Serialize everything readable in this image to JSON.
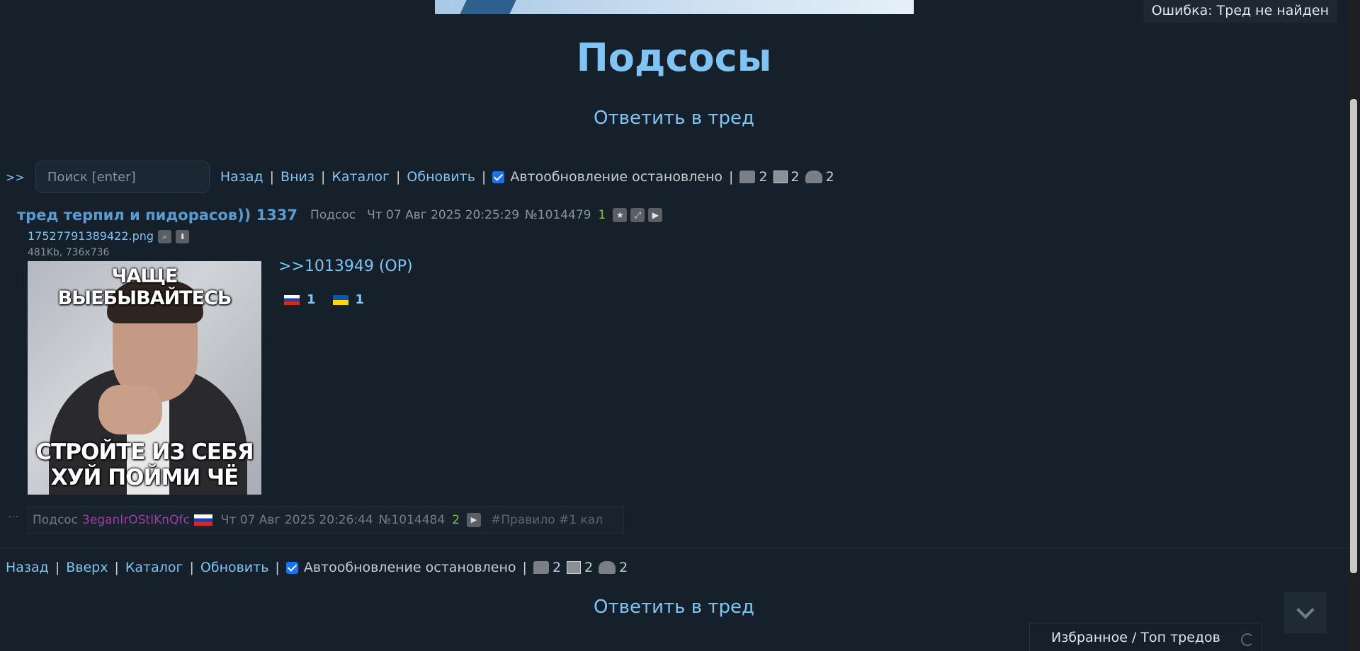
{
  "error_toast": "Ошибка: Тред не найден",
  "board": {
    "title": "Подсосы"
  },
  "reply_link": "Ответить в тред",
  "nav_top": {
    "prefix": ">>",
    "search_placeholder": "Поиск [enter]",
    "links": [
      "Назад",
      "Вниз",
      "Каталог",
      "Обновить"
    ],
    "autoupdate": "Автообновление остановлено",
    "stats": {
      "posts": "2",
      "images": "2",
      "users": "2"
    }
  },
  "op": {
    "subject": "тред терпил и пидорасов)) 1337",
    "name": "Подсос",
    "date": "Чт 07 Авг 2025 20:25:29",
    "number": "№1014479",
    "replies": "1",
    "file_name": "17527791389422.png",
    "file_meta": "481Kb, 736x736",
    "meme_top": "ЧАЩЕ ВЫЕБЫВАЙТЕСЬ",
    "meme_bottom_1": "СТРОЙТЕ ИЗ СЕБЯ",
    "meme_bottom_2": "ХУЙ ПОЙМИ ЧЁ",
    "quote": ">>1013949 (OP)",
    "flag_ru_count": "1",
    "flag_ua_count": "1"
  },
  "reply": {
    "dots": "⋯",
    "name": "Подсос",
    "id": "3eganIrOStIKnQfc",
    "date": "Чт 07 Авг 2025 20:26:44",
    "number": "№1014484",
    "replies": "2",
    "tag": "#Правило #1 кал"
  },
  "nav_bottom": {
    "links": [
      "Назад",
      "Вверх",
      "Каталог",
      "Обновить"
    ],
    "autoupdate": "Автообновление остановлено",
    "stats": {
      "posts": "2",
      "images": "2",
      "users": "2"
    }
  },
  "fav_panel": "Избранное / Топ тредов"
}
